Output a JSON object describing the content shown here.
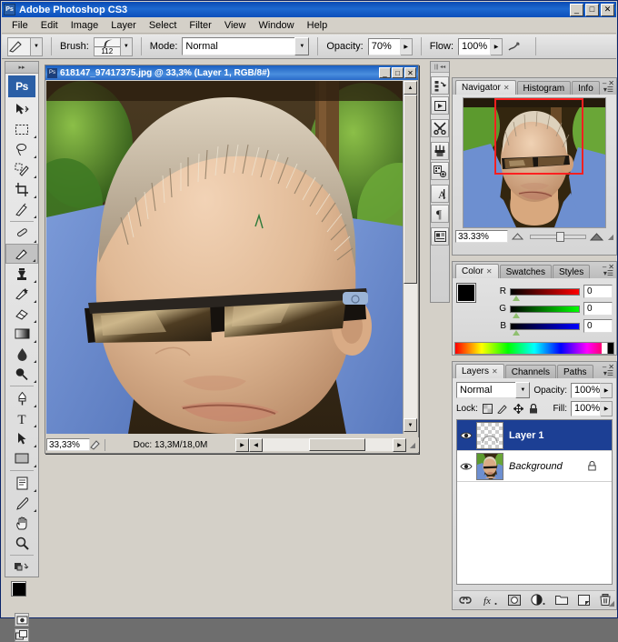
{
  "app": {
    "title": "Adobe Photoshop CS3",
    "logo_text": "Ps",
    "window_buttons": {
      "minimize": "_",
      "maximize": "□",
      "close": "✕"
    }
  },
  "menubar": {
    "items": [
      "File",
      "Edit",
      "Image",
      "Layer",
      "Select",
      "Filter",
      "View",
      "Window",
      "Help"
    ]
  },
  "options_bar": {
    "tool_icon": "brush-icon",
    "brush_label": "Brush:",
    "brush_size": "112",
    "mode_label": "Mode:",
    "mode_value": "Normal",
    "opacity_label": "Opacity:",
    "opacity_value": "70%",
    "flow_label": "Flow:",
    "flow_value": "100%",
    "airbrush_icon": "airbrush-icon"
  },
  "toolbox": {
    "logo": "Ps",
    "tools": [
      {
        "name": "move-tool",
        "glyph": "✥",
        "has_submenu": false
      },
      {
        "name": "rectangular-marquee-tool",
        "glyph": "▭",
        "has_submenu": true
      },
      {
        "name": "lasso-tool",
        "glyph": "◯",
        "has_submenu": true
      },
      {
        "name": "quick-selection-tool",
        "glyph": "✎",
        "has_submenu": true
      },
      {
        "name": "crop-tool",
        "glyph": "⌗",
        "has_submenu": true
      },
      {
        "name": "eyedropper-tool",
        "glyph": "✒",
        "has_submenu": true
      },
      {
        "name": "healing-brush-tool",
        "glyph": "⟋",
        "has_submenu": true
      },
      {
        "name": "brush-tool",
        "glyph": "✏",
        "has_submenu": true,
        "selected": true
      },
      {
        "name": "clone-stamp-tool",
        "glyph": "⚱",
        "has_submenu": true
      },
      {
        "name": "history-brush-tool",
        "glyph": "❧",
        "has_submenu": true
      },
      {
        "name": "eraser-tool",
        "glyph": "▱",
        "has_submenu": true
      },
      {
        "name": "gradient-tool",
        "glyph": "▬",
        "has_submenu": true
      },
      {
        "name": "blur-tool",
        "glyph": "💧",
        "has_submenu": true
      },
      {
        "name": "dodge-tool",
        "glyph": "●",
        "has_submenu": true
      },
      {
        "name": "pen-tool",
        "glyph": "✐",
        "has_submenu": true
      },
      {
        "name": "horizontal-type-tool",
        "glyph": "T",
        "has_submenu": true
      },
      {
        "name": "path-selection-tool",
        "glyph": "➤",
        "has_submenu": true
      },
      {
        "name": "rectangle-shape-tool",
        "glyph": "▭",
        "has_submenu": true
      },
      {
        "name": "notes-tool",
        "glyph": "🗒",
        "has_submenu": true
      },
      {
        "name": "eyedropper-sample-tool",
        "glyph": "⚲",
        "has_submenu": true
      },
      {
        "name": "hand-tool",
        "glyph": "✋",
        "has_submenu": false
      },
      {
        "name": "zoom-tool",
        "glyph": "🔍",
        "has_submenu": false
      }
    ],
    "foreground_color": "#000000",
    "background_color": "#ffffff",
    "quick_mask_icon": "quick-mask-icon",
    "screen_mode_icon": "screen-mode-icon"
  },
  "document": {
    "title": "618147_97417375.jpg @ 33,3% (Layer 1, RGB/8#)",
    "status_zoom": "33,33%",
    "status_doc": "Doc: 13,3M/18,0M",
    "window_buttons": {
      "minimize": "_",
      "maximize": "□",
      "close": "✕"
    }
  },
  "dock_strip": {
    "icons": [
      {
        "name": "history-panel-icon",
        "glyph": "↻"
      },
      {
        "name": "actions-panel-icon",
        "glyph": "▶"
      },
      {
        "name": "tool-presets-panel-icon",
        "glyph": "✂"
      },
      {
        "name": "brushes-panel-icon",
        "glyph": "🖌"
      },
      {
        "name": "clone-source-panel-icon",
        "glyph": "⧉"
      },
      {
        "name": "character-panel-icon",
        "glyph": "A"
      },
      {
        "name": "paragraph-panel-icon",
        "glyph": "¶"
      },
      {
        "name": "layer-comps-panel-icon",
        "glyph": "▤"
      }
    ]
  },
  "navigator": {
    "tabs": [
      {
        "label": "Navigator",
        "active": true,
        "closeable": true
      },
      {
        "label": "Histogram",
        "active": false,
        "closeable": false
      },
      {
        "label": "Info",
        "active": false,
        "closeable": false
      }
    ],
    "zoom_value": "33.33%",
    "view_box_color": "#ff2020",
    "zoom_out_icon": "zoom-out-icon",
    "zoom_in_icon": "zoom-in-icon"
  },
  "color_panel": {
    "tabs": [
      {
        "label": "Color",
        "active": true,
        "closeable": true
      },
      {
        "label": "Swatches",
        "active": false,
        "closeable": false
      },
      {
        "label": "Styles",
        "active": false,
        "closeable": false
      }
    ],
    "channels": [
      {
        "label": "R",
        "value": "0",
        "ramp_from": "#000000",
        "ramp_to": "#ff0000"
      },
      {
        "label": "G",
        "value": "0",
        "ramp_from": "#000000",
        "ramp_to": "#00ff00"
      },
      {
        "label": "B",
        "value": "0",
        "ramp_from": "#000000",
        "ramp_to": "#0000ff"
      }
    ],
    "foreground_color": "#000000",
    "background_color": "#ffffff"
  },
  "layers_panel": {
    "tabs": [
      {
        "label": "Layers",
        "active": true,
        "closeable": true
      },
      {
        "label": "Channels",
        "active": false,
        "closeable": false
      },
      {
        "label": "Paths",
        "active": false,
        "closeable": false
      }
    ],
    "blend_mode": "Normal",
    "opacity_label": "Opacity:",
    "opacity_value": "100%",
    "lock_label": "Lock:",
    "lock_icons": [
      {
        "name": "lock-transparency-icon",
        "glyph": "▧"
      },
      {
        "name": "lock-image-icon",
        "glyph": "✎"
      },
      {
        "name": "lock-position-icon",
        "glyph": "✥"
      },
      {
        "name": "lock-all-icon",
        "glyph": "🔒"
      }
    ],
    "fill_label": "Fill:",
    "fill_value": "100%",
    "layers": [
      {
        "name": "Layer 1",
        "selected": true,
        "visible": true,
        "locked": false,
        "thumb": "transparent",
        "style": "bold"
      },
      {
        "name": "Background",
        "selected": false,
        "visible": true,
        "locked": true,
        "thumb": "photo",
        "style": "italic"
      }
    ],
    "footer_buttons": [
      {
        "name": "link-layers-button",
        "glyph": "⛓"
      },
      {
        "name": "layer-style-button",
        "glyph": "fx"
      },
      {
        "name": "layer-mask-button",
        "glyph": "◉"
      },
      {
        "name": "adjustment-layer-button",
        "glyph": "◑"
      },
      {
        "name": "new-group-button",
        "glyph": "▭"
      },
      {
        "name": "new-layer-button",
        "glyph": "⬓"
      },
      {
        "name": "delete-layer-button",
        "glyph": "🗑"
      }
    ]
  }
}
